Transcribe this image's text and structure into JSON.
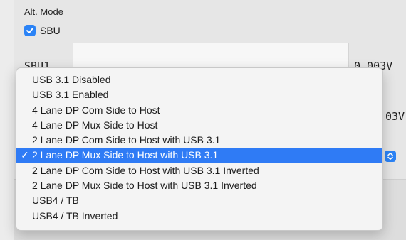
{
  "section": {
    "title": "Alt. Mode"
  },
  "sbu_checkbox": {
    "label": "SBU",
    "checked": true
  },
  "sbu1": {
    "label": "SBU1",
    "value": "0.003V"
  },
  "sbu2": {
    "value_partial": "03V"
  },
  "colors": {
    "accent": "#2f7bf5",
    "checkbox": "#2b83f6"
  },
  "icons": {
    "checkbox": "checkmark-icon",
    "select": "chevron-up-down-icon",
    "selected_item": "checkmark-icon"
  },
  "menu": {
    "selected_index": 5,
    "selected_mark": "✓",
    "items": [
      "USB 3.1 Disabled",
      "USB 3.1 Enabled",
      "4 Lane DP Com Side to Host",
      "4 Lane DP Mux Side to Host",
      "2 Lane DP Com Side to Host with USB 3.1",
      "2 Lane DP Mux Side to Host with USB 3.1",
      "2 Lane DP Com Side to Host with USB 3.1 Inverted",
      "2 Lane DP Mux Side to Host with USB 3.1 Inverted",
      "USB4 / TB",
      "USB4 / TB Inverted"
    ]
  }
}
